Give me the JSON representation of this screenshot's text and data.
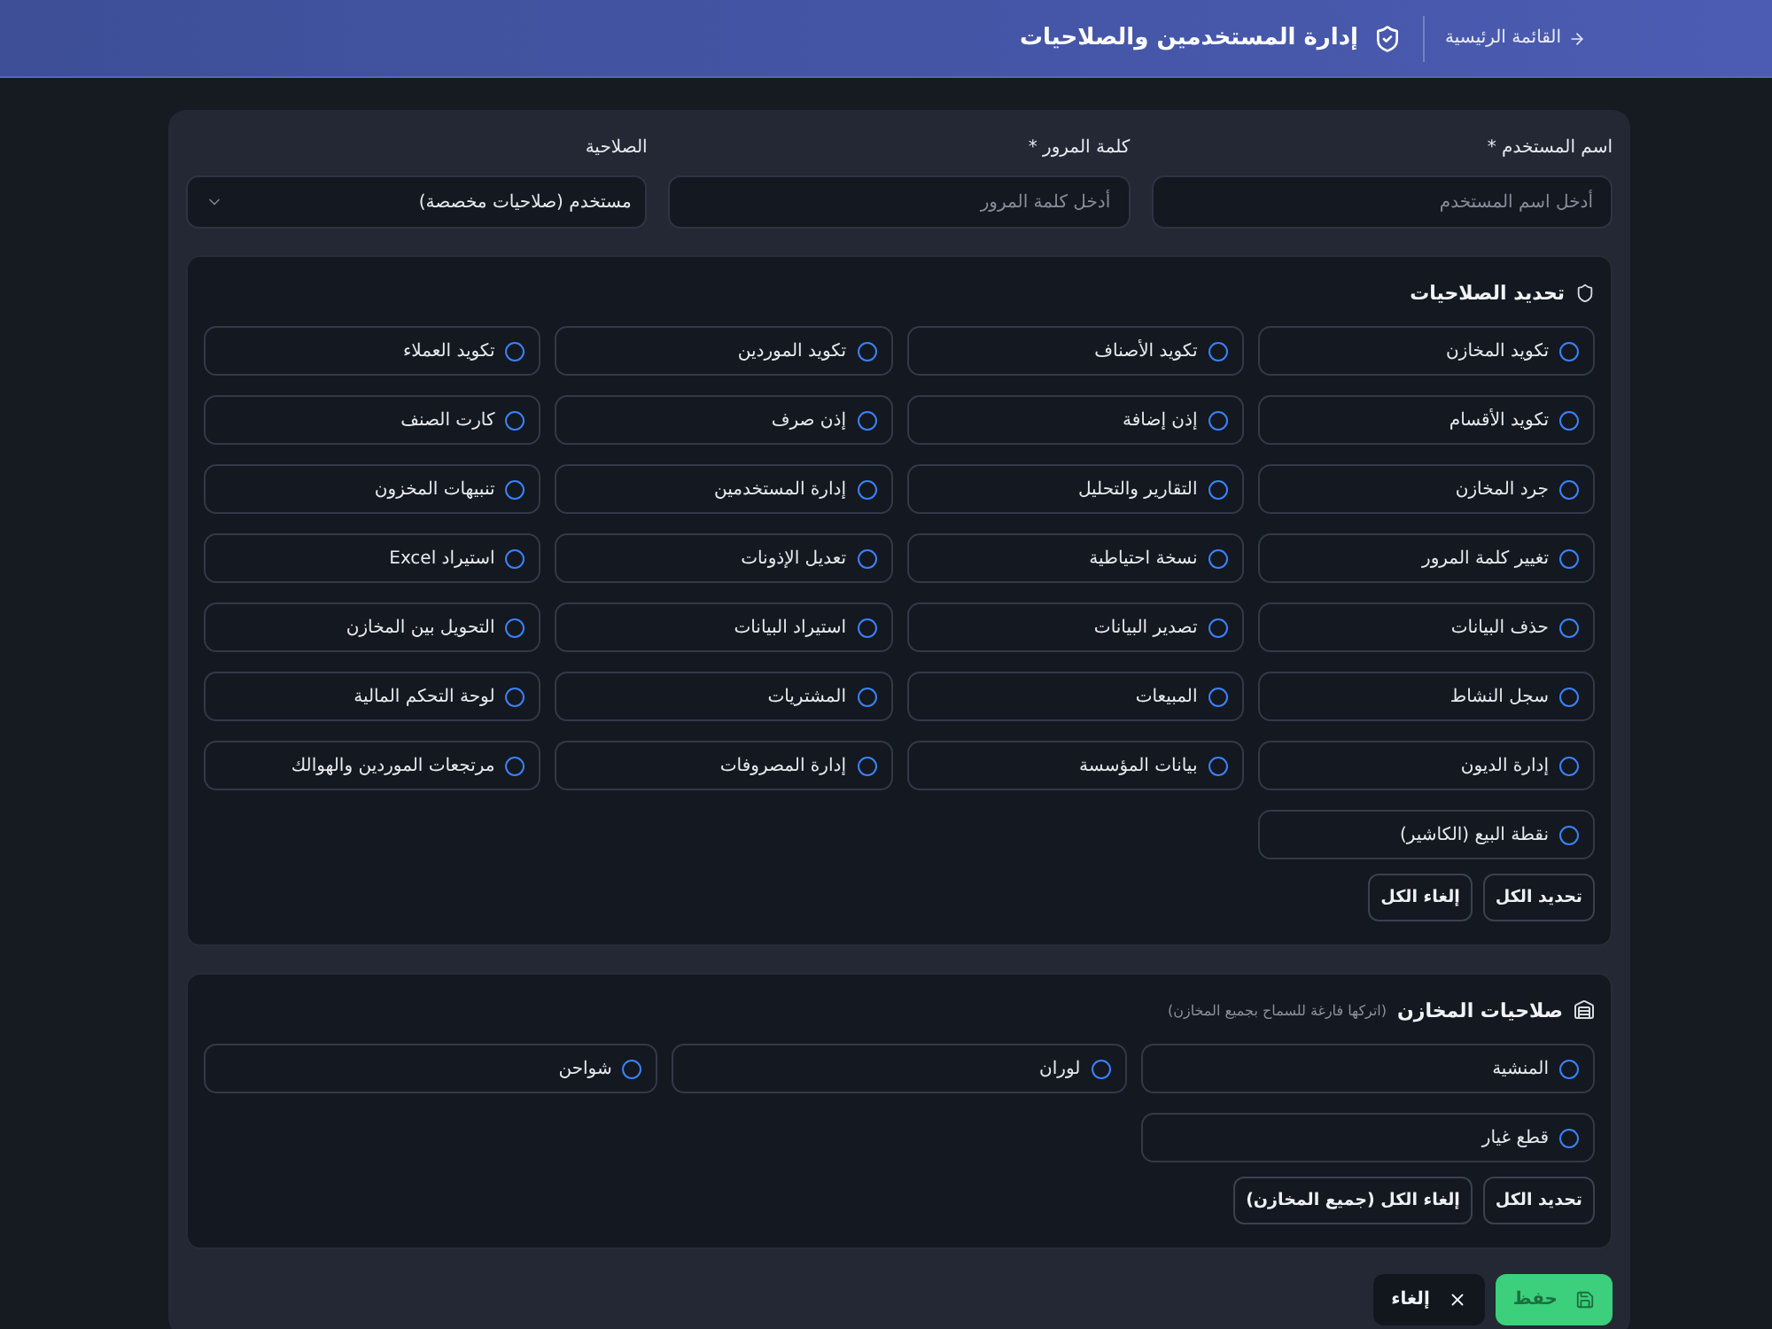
{
  "header": {
    "back_link": "القائمة الرئيسية",
    "title": "إدارة المستخدمين والصلاحيات"
  },
  "fields": [
    {
      "kind": "text",
      "label": "اسم المستخدم *",
      "placeholder": "أدخل اسم المستخدم"
    },
    {
      "kind": "password",
      "label": "كلمة المرور *",
      "placeholder": "أدخل كلمة المرور"
    },
    {
      "kind": "select",
      "label": "الصلاحية",
      "value": "مستخدم (صلاحيات مخصصة)"
    }
  ],
  "permissions": {
    "title": "تحديد الصلاحيات",
    "items": [
      {
        "label": "تكويد المخازن",
        "checked": false
      },
      {
        "label": "تكويد الأصناف",
        "checked": false
      },
      {
        "label": "تكويد الموردين",
        "checked": false
      },
      {
        "label": "تكويد العملاء",
        "checked": false
      },
      {
        "label": "تكويد الأقسام",
        "checked": false
      },
      {
        "label": "إذن إضافة",
        "checked": false
      },
      {
        "label": "إذن صرف",
        "checked": false
      },
      {
        "label": "كارت الصنف",
        "checked": false
      },
      {
        "label": "جرد المخازن",
        "checked": false
      },
      {
        "label": "التقارير والتحليل",
        "checked": false
      },
      {
        "label": "إدارة المستخدمين",
        "checked": false
      },
      {
        "label": "تنبيهات المخزون",
        "checked": false
      },
      {
        "label": "تغيير كلمة المرور",
        "checked": false
      },
      {
        "label": "نسخة احتياطية",
        "checked": false
      },
      {
        "label": "تعديل الإذونات",
        "checked": false
      },
      {
        "label": "استيراد Excel",
        "checked": false
      },
      {
        "label": "حذف البيانات",
        "checked": false
      },
      {
        "label": "تصدير البيانات",
        "checked": false
      },
      {
        "label": "استيراد البيانات",
        "checked": false
      },
      {
        "label": "التحويل بين المخازن",
        "checked": false
      },
      {
        "label": "سجل النشاط",
        "checked": false
      },
      {
        "label": "المبيعات",
        "checked": false
      },
      {
        "label": "المشتريات",
        "checked": false
      },
      {
        "label": "لوحة التحكم المالية",
        "checked": false
      },
      {
        "label": "إدارة الديون",
        "checked": false
      },
      {
        "label": "بيانات المؤسسة",
        "checked": false
      },
      {
        "label": "إدارة المصروفات",
        "checked": false
      },
      {
        "label": "مرتجعات الموردين والهوالك",
        "checked": false
      },
      {
        "label": "نقطة البيع (الكاشير)",
        "checked": false
      }
    ],
    "buttons": [
      "تحديد الكل",
      "إلغاء الكل"
    ]
  },
  "warehouses": {
    "title": "صلاحيات المخازن",
    "note": "(اتركها فارغة للسماح بجميع المخازن)",
    "items": [
      {
        "label": "المنشية",
        "checked": false
      },
      {
        "label": "لوران",
        "checked": false
      },
      {
        "label": "شواحن",
        "checked": false
      },
      {
        "label": "قطع غيار",
        "checked": false
      }
    ],
    "buttons": [
      "تحديد الكل",
      "إلغاء الكل (جميع المخازن)"
    ]
  },
  "actions": [
    {
      "kind": "save",
      "label": "حفظ"
    },
    {
      "kind": "cancel",
      "label": "إلغاء"
    }
  ]
}
